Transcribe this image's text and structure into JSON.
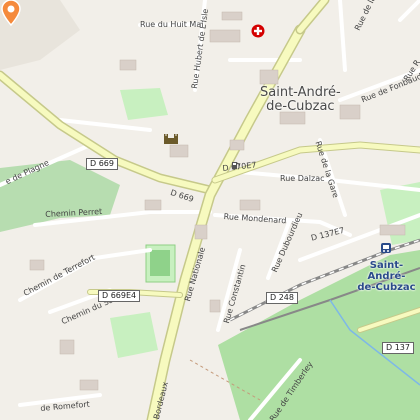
{
  "map": {
    "towns": [
      {
        "id": "town-saint-andre",
        "text": "Saint-André-\nde-Cubzac"
      }
    ],
    "station_label": "Saint-André-\nde-Cubzac",
    "streets": [
      {
        "id": "rue-du-huit-mai",
        "text": "Rue du Huit Mai"
      },
      {
        "id": "rue-hubert-de-lisle",
        "text": "Rue Hubert de L'Isle"
      },
      {
        "id": "rue-de-plagne",
        "text": "e de Plagne"
      },
      {
        "id": "rue-dalzac",
        "text": "Rue Dalzac"
      },
      {
        "id": "rue-de-la-gare",
        "text": "Rue de la Gare"
      },
      {
        "id": "rue-de-fonbaudeau",
        "text": "Rue de Fonbaudeau"
      },
      {
        "id": "rue-nationale",
        "text": "Rue Nationale"
      },
      {
        "id": "rue-mondenard",
        "text": "Rue Mondenard"
      },
      {
        "id": "chemin-perret",
        "text": "Chemin Perret"
      },
      {
        "id": "chemin-de-terrefort",
        "text": "Chemin de Terrefort"
      },
      {
        "id": "chemin-du-sabiot",
        "text": "Chemin du Sabiot"
      },
      {
        "id": "rue-dubourdieu",
        "text": "Rue Dubourdieu"
      },
      {
        "id": "rue-constantin",
        "text": "Rue Constantin"
      },
      {
        "id": "rue-de-bordeaux",
        "text": "Bordeaux"
      },
      {
        "id": "rue-de-la-d",
        "text": "Rue de la D"
      },
      {
        "id": "rue-r",
        "text": "Rue R"
      },
      {
        "id": "rue-de-romefort",
        "text": "de Romefort"
      },
      {
        "id": "rue-de-timberley",
        "text": "Rue de Timberley"
      }
    ],
    "road_shields": [
      {
        "id": "shield-d669-west",
        "text": "D 669"
      },
      {
        "id": "shield-d669-center",
        "text": "D 669"
      },
      {
        "id": "shield-d670e7",
        "text": "D 670E7"
      },
      {
        "id": "shield-d669e4",
        "text": "D 669E4"
      },
      {
        "id": "shield-d248",
        "text": "D 248"
      },
      {
        "id": "shield-d137e7",
        "text": "D 137E7"
      },
      {
        "id": "shield-d137",
        "text": "D 137"
      }
    ],
    "icons": {
      "hospital": "hospital-cross-icon",
      "castle": "castle-icon",
      "place_marker": "location-pin-icon",
      "fuel": "fuel-icon",
      "station": "train-station-icon"
    },
    "colors": {
      "background": "#f2efe9",
      "main_road": "#f7fabf",
      "main_road_casing": "#c6c98a",
      "vineyard": "#aedfa3",
      "park": "#c8f0c0",
      "building": "#d9d0c9",
      "railway": "#888888",
      "marker": "#f58a3c",
      "station": "#2a4b8a",
      "hospital": "#d40000"
    }
  }
}
